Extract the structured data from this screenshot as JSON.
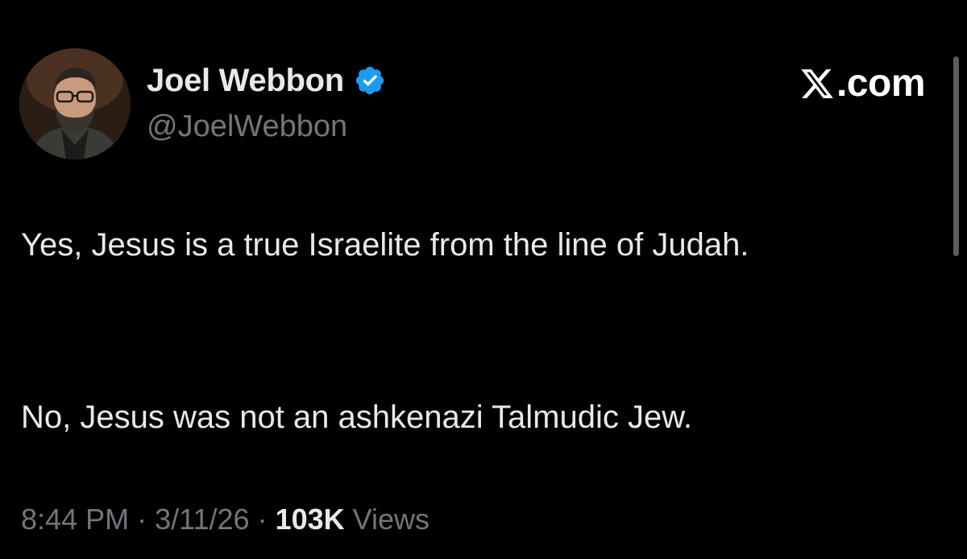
{
  "author": {
    "display_name": "Joel Webbon",
    "handle": "@JoelWebbon",
    "verified": true,
    "verified_color": "#1d9bf0"
  },
  "brand": {
    "suffix": ".com"
  },
  "tweet": {
    "paragraphs": [
      "Yes, Jesus is a true Israelite from the line of Judah.",
      "No, Jesus was not an ashkenazi Talmudic Jew."
    ]
  },
  "meta": {
    "time": "8:44 PM",
    "separator": "·",
    "date": "3/11/26",
    "views_count": "103K",
    "views_label": "Views"
  },
  "colors": {
    "background": "#000000",
    "text": "#e7e9ea",
    "secondary_text": "#71767b"
  },
  "icons": {
    "avatar": "profile-photo",
    "verified": "verified-badge-icon",
    "brand": "x-logo-icon"
  }
}
